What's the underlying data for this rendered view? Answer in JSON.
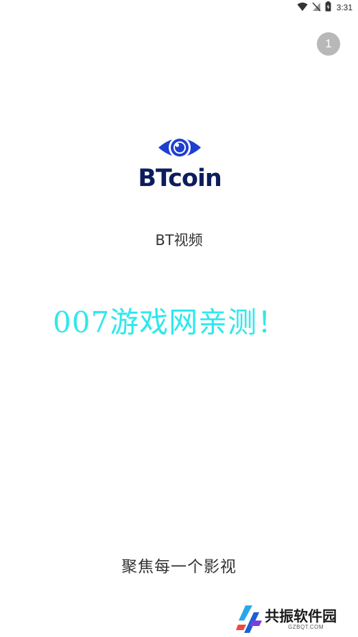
{
  "status_bar": {
    "time": "3:31",
    "icons": [
      "wifi-icon",
      "no-signal-icon",
      "battery-charging-icon"
    ]
  },
  "splash": {
    "countdown": "1",
    "logo_text": "BTcoin",
    "app_name": "BT视频",
    "watermark": "007游戏网亲测！",
    "slogan": "聚焦每一个影视"
  },
  "site_badge": {
    "name": "共振软件园",
    "url": "GZBQT.COM"
  },
  "colors": {
    "logo_blue": "#1f3fd1",
    "logo_text": "#0d1d5c",
    "watermark": "#2ee8ec",
    "countdown_bg": "#b8b8b8"
  }
}
